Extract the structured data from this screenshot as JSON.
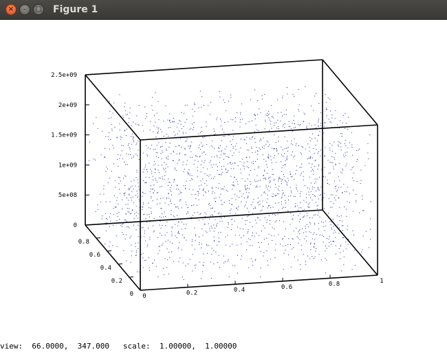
{
  "window": {
    "title": "Figure 1",
    "buttons": {
      "close": "×",
      "minimize": "–",
      "maximize": "□"
    }
  },
  "status": {
    "view_label": "view:",
    "view_value": "66.0000,  347.000",
    "scale_label": "scale:",
    "scale_value": "1.00000,  1.00000"
  },
  "colors": {
    "points": "#1414c8",
    "titlebar": "#3c3b37",
    "close_button": "#df4b16"
  },
  "chart_data": {
    "type": "scatter",
    "projection": "3d",
    "x_ticks": [
      "0",
      "0.2",
      "0.4",
      "0.6",
      "0.8",
      "1"
    ],
    "y_ticks": [
      "0",
      "0.2",
      "0.4",
      "0.6",
      "0.8"
    ],
    "z_ticks": [
      "0",
      "5e+08",
      "1e+09",
      "1.5e+09",
      "2e+09",
      "2.5e+09"
    ],
    "xlim": [
      0,
      1
    ],
    "ylim": [
      0,
      1
    ],
    "zlim": [
      0,
      2500000000
    ],
    "point_distribution": "uniform random",
    "x_range": [
      0,
      1
    ],
    "y_range": [
      0,
      1
    ],
    "z_range": [
      0,
      2200000000
    ],
    "point_count": 2000,
    "marker": "dot",
    "grid": false,
    "box": true
  }
}
